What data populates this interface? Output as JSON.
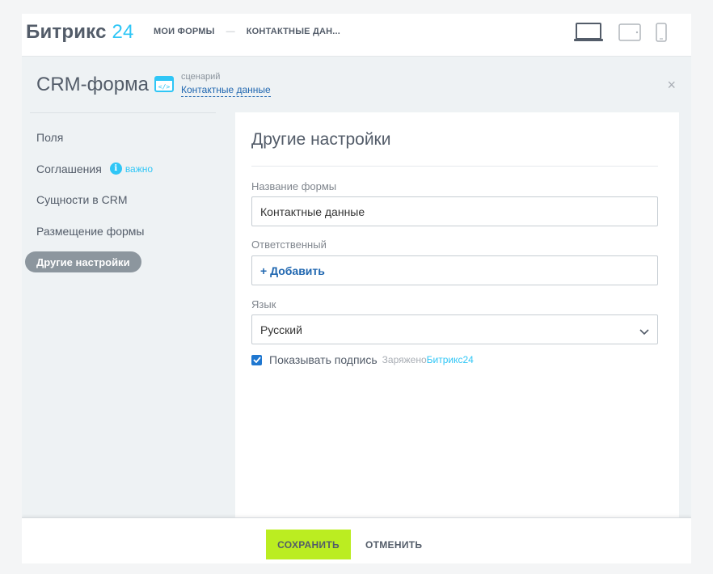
{
  "app": {
    "logo_text": "Битрикс",
    "logo_num": "24"
  },
  "breadcrumbs": {
    "first": "МОИ ФОРМЫ",
    "separator": "—",
    "second": "КОНТАКТНЫЕ ДАН..."
  },
  "devices": [
    "laptop-icon",
    "tablet-icon",
    "phone-icon"
  ],
  "header": {
    "title": "CRM-форма",
    "scenario_caption": "сценарий",
    "scenario_link": "Контактные данные",
    "close": "×"
  },
  "sidebar": {
    "items": [
      {
        "label": "Поля"
      },
      {
        "label": "Соглашения",
        "badge": "важно"
      },
      {
        "label": "Сущности в CRM"
      },
      {
        "label": "Размещение формы"
      },
      {
        "label": "Другие настройки",
        "active": true
      }
    ]
  },
  "panel": {
    "title": "Другие настройки",
    "form_name_label": "Название формы",
    "form_name_value": "Контактные данные",
    "responsible_label": "Ответственный",
    "responsible_add": "+ Добавить",
    "language_label": "Язык",
    "language_value": "Русский",
    "show_signature_label": "Показывать подпись",
    "show_signature_checked": true,
    "powered_text": "Заряжено",
    "powered_brand": "Битрикс24"
  },
  "footer": {
    "save": "СОХРАНИТЬ",
    "cancel": "ОТМЕНИТЬ"
  },
  "colors": {
    "accent_blue": "#2fc6f6",
    "link_blue": "#2067b0",
    "save_green": "#bbed21",
    "nav_active": "#8c969e"
  }
}
